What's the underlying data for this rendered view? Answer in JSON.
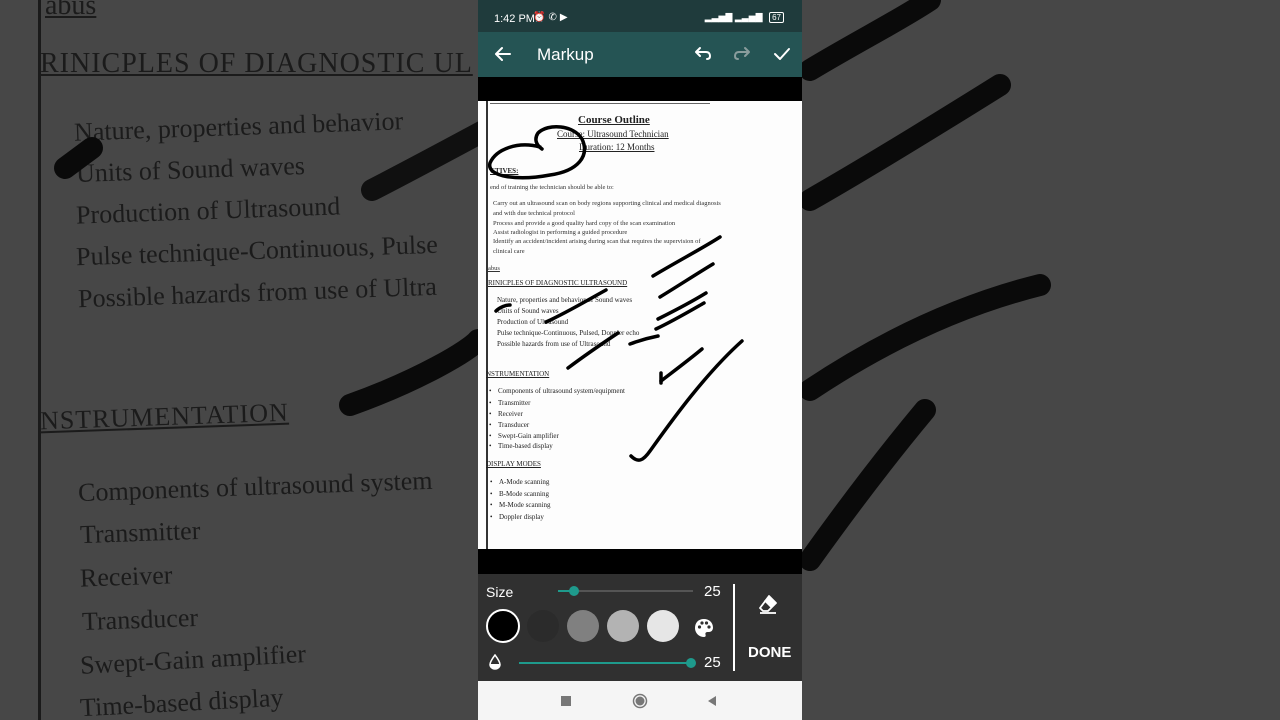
{
  "status_bar": {
    "time": "1:42 PM",
    "battery": "67"
  },
  "app_bar": {
    "title": "Markup"
  },
  "document": {
    "title": "Course Outline",
    "course": "Course: Ultrasound Technician",
    "duration": "Duration: 12 Months",
    "objectives_heading": "CTIVES:",
    "objectives_intro": "end of training the technician should be able to:",
    "objectives": [
      "Carry out an ultrasound scan on body regions supporting clinical and medical diagnosis",
      "and with due technical protocol",
      "Process and provide a good quality hard copy of the scan examination",
      "Assist radiologist in performing a guided procedure",
      "Identify an accident/incident arising during scan that requires the supervision of",
      "clinical care"
    ],
    "syllabus_heading": "abus",
    "principles_heading": "RINICPLES OF DIAGNOSTIC ULTRASOUND",
    "principles": [
      "Nature, properties and behavior of Sound waves",
      "Units of Sound waves",
      "Production of Ultrasound",
      "Pulse technique-Continuous, Pulsed, Doppler echo",
      "Possible hazards from use of Ultrasound"
    ],
    "instrumentation_heading": "NSTRUMENTATION",
    "instrumentation": [
      "Components of ultrasound system/equipment",
      "Transmitter",
      "Receiver",
      "Transducer",
      "Swept-Gain amplifier",
      "Time-based display"
    ],
    "display_heading": "DISPLAY MODES",
    "display": [
      "A-Mode scanning",
      "B-Mode scanning",
      "M-Mode scanning",
      "Doppler display"
    ]
  },
  "background_text": {
    "heading_top": "abus",
    "principles_heading": "RINICPLES OF DIAGNOSTIC UL",
    "principles": [
      "Nature, properties and behavior",
      "Units of Sound waves",
      "Production of Ultrasound",
      "Pulse technique-Continuous, Pulse",
      "Possible hazards from use of Ultra"
    ],
    "instrumentation_heading": "NSTRUMENTATION",
    "instrumentation": [
      "Components of ultrasound system",
      "Transmitter",
      "Receiver",
      "Transducer",
      "Swept-Gain amplifier",
      "Time-based display"
    ]
  },
  "tools": {
    "size_label": "Size",
    "size_value": "25",
    "size_level": 0.12,
    "opacity_value": "25",
    "opacity_level": 1.0,
    "done_label": "DONE",
    "swatches": [
      "#000000",
      "#2b2b2b",
      "#808080",
      "#b3b3b3",
      "#e6e6e6"
    ],
    "accent": "#1e9a8c"
  },
  "colors": {
    "status_bar": "#1f3b3c",
    "app_bar": "#255454",
    "panel": "#303030"
  }
}
